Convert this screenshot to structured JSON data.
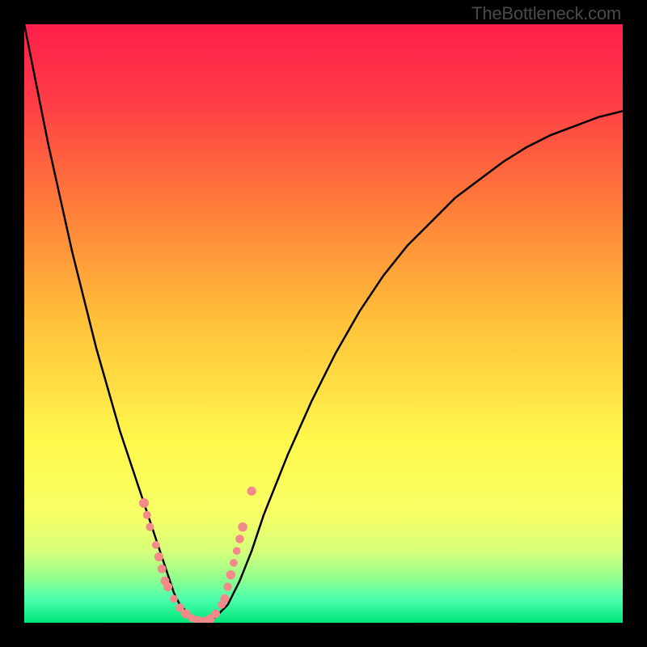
{
  "watermark": "TheBottleneck.com",
  "chart_data": {
    "type": "line",
    "title": "",
    "xlabel": "",
    "ylabel": "",
    "xlim": [
      0,
      100
    ],
    "ylim": [
      0,
      100
    ],
    "x": [
      0,
      2,
      4,
      6,
      8,
      10,
      12,
      14,
      16,
      18,
      20,
      21,
      22,
      23,
      24,
      25,
      26,
      27,
      28,
      30,
      32,
      34,
      36,
      38,
      40,
      44,
      48,
      52,
      56,
      60,
      64,
      68,
      72,
      76,
      80,
      84,
      88,
      92,
      96,
      100
    ],
    "values": [
      100,
      90,
      80,
      71,
      62,
      54,
      46,
      39,
      32,
      26,
      20,
      17,
      14,
      11,
      8,
      5,
      3,
      2,
      1,
      0,
      1,
      3,
      7,
      12,
      18,
      28,
      37,
      45,
      52,
      58,
      63,
      67,
      71,
      74,
      77,
      79.5,
      81.5,
      83,
      84.5,
      85.5
    ],
    "annotations": {
      "marker_color": "#f38a8a",
      "markers_left": [
        {
          "x": 20,
          "y": 20
        },
        {
          "x": 20.5,
          "y": 18
        },
        {
          "x": 21,
          "y": 16
        },
        {
          "x": 22,
          "y": 13
        },
        {
          "x": 22.5,
          "y": 11
        },
        {
          "x": 23,
          "y": 9
        },
        {
          "x": 23.5,
          "y": 7
        },
        {
          "x": 24,
          "y": 6
        },
        {
          "x": 25,
          "y": 4
        },
        {
          "x": 26,
          "y": 2.5
        },
        {
          "x": 27,
          "y": 1.5
        },
        {
          "x": 28,
          "y": 0.8
        },
        {
          "x": 29,
          "y": 0.3
        }
      ],
      "markers_right": [
        {
          "x": 30,
          "y": 0.2
        },
        {
          "x": 31,
          "y": 0.6
        },
        {
          "x": 32,
          "y": 1.5
        },
        {
          "x": 33,
          "y": 3
        },
        {
          "x": 33.5,
          "y": 4
        },
        {
          "x": 34,
          "y": 6
        },
        {
          "x": 34.5,
          "y": 8
        },
        {
          "x": 35,
          "y": 10
        },
        {
          "x": 35.5,
          "y": 12
        },
        {
          "x": 36,
          "y": 14
        },
        {
          "x": 36.5,
          "y": 16
        },
        {
          "x": 38,
          "y": 22
        }
      ]
    },
    "gradient_stops": [
      {
        "pos": 0.0,
        "color": "#ff1f4a"
      },
      {
        "pos": 0.12,
        "color": "#ff3a47"
      },
      {
        "pos": 0.3,
        "color": "#ff7b3a"
      },
      {
        "pos": 0.5,
        "color": "#ffc23a"
      },
      {
        "pos": 0.7,
        "color": "#fff94d"
      },
      {
        "pos": 0.82,
        "color": "#f7ff66"
      },
      {
        "pos": 0.88,
        "color": "#d6ff7a"
      },
      {
        "pos": 0.92,
        "color": "#9bff8a"
      },
      {
        "pos": 0.96,
        "color": "#4dffad"
      },
      {
        "pos": 1.0,
        "color": "#00e67a"
      }
    ]
  }
}
